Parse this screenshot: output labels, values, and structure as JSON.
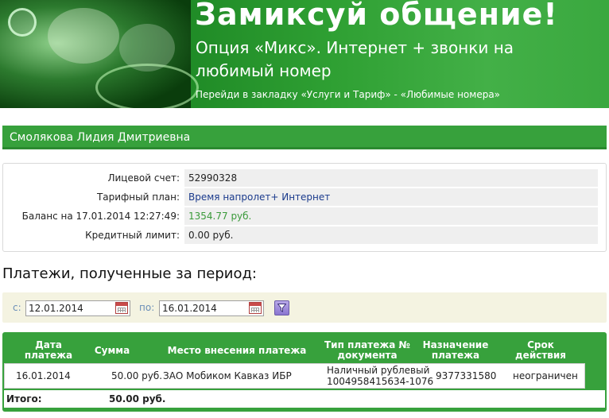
{
  "banner": {
    "title": "Замиксуй общение!",
    "subtitle": "Опция «Микс». Интернет + звонки на любимый номер",
    "link": "Перейди в закладку «Услуги и Тариф» - «Любимые номера»"
  },
  "subscriber": {
    "name": "Смолякова Лидия Дмитриевна"
  },
  "account": {
    "account_label": "Лицевой счет:",
    "account_value": "52990328",
    "tariff_label": "Тарифный план:",
    "tariff_value": "Время напролет+ Интернет",
    "balance_label": "Баланс на 17.01.2014 12:27:49:",
    "balance_value": "1354.77 руб.",
    "credit_label": "Кредитный лимит:",
    "credit_value": "0.00 руб."
  },
  "payments": {
    "title": "Платежи, полученные за период:",
    "filter": {
      "from_label": "с:",
      "from_value": "12.01.2014",
      "to_label": "по:",
      "to_value": "16.01.2014"
    },
    "columns": {
      "date": "Дата платежа",
      "amount": "Сумма",
      "place": "Место внесения платежа",
      "type": "Тип платежа № документа",
      "purpose": "Назначение платежа",
      "term": "Срок действия"
    },
    "rows": [
      {
        "date": "16.01.2014",
        "amount": "50.00 руб.",
        "place": "ЗАО Мобиком Кавказ ИБР",
        "type": "Наличный рублевый",
        "doc": "1004958415634-1076",
        "purpose": "9377331580",
        "term": "неограничен"
      }
    ],
    "total_label": "Итого:",
    "total_value": "50.00 руб."
  },
  "colors": {
    "brand_green": "#37a13c",
    "link_blue": "#1a3a8c",
    "balance_green": "#3a9a3a",
    "filter_bg": "#f4f3e1"
  },
  "icons": {
    "calendar": "calendar-icon",
    "filter": "filter-icon"
  }
}
